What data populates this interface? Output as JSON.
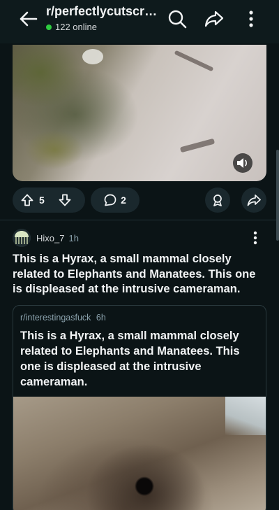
{
  "header": {
    "subreddit": "r/perfectlycutscre...",
    "online_status": "122 online"
  },
  "post1": {
    "votes": "5",
    "comments": "2"
  },
  "post2": {
    "author": "Hixo_7",
    "age": "1h",
    "title": "This is a Hyrax, a small mammal closely related to Elephants and Manatees. This one is displeased at the intrusive cameraman.",
    "crosspost": {
      "subreddit": "r/interestingasfuck",
      "age": "6h",
      "title": "This is a Hyrax, a small mammal closely related to Elephants and Manatees. This one is displeased at the intrusive cameraman."
    }
  },
  "icons": {
    "back": "arrow-left-icon",
    "search": "search-icon",
    "share": "share-icon",
    "more": "more-vertical-icon",
    "upvote": "upvote-icon",
    "downvote": "downvote-icon",
    "comment": "comment-icon",
    "award": "award-icon",
    "sound": "volume-icon"
  },
  "colors": {
    "background": "#0b1416",
    "online_dot": "#2ecc40",
    "pill": "#1a282d"
  }
}
